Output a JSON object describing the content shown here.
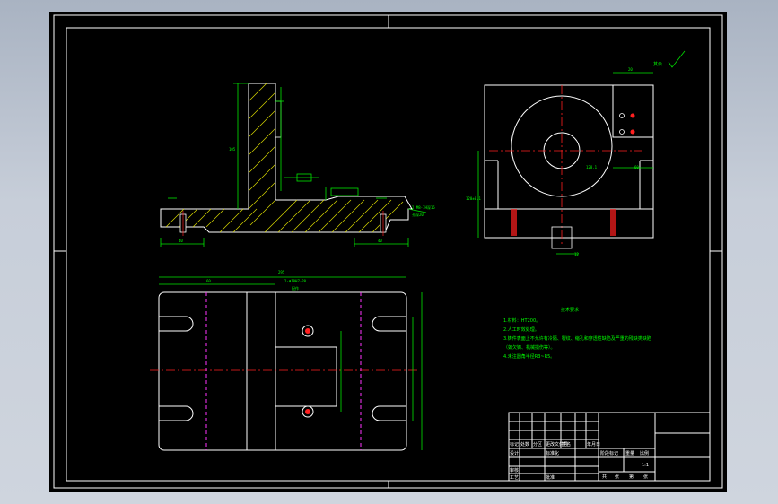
{
  "technical_requirements": {
    "title": "技术要求",
    "lines": [
      "1.材料：HT200。",
      "2.人工时效处理。",
      "3.铸件表面上不允许有冷隔、裂纹、缩孔和穿透性缺陷及严重的残缺类缺陷",
      "（如欠铸、机械损伤等）。",
      "4.未注圆角半径R3~R5。"
    ]
  },
  "roughness_note": "其余",
  "dimensions": {
    "top_overall": "295",
    "top_left": "60",
    "top_right_small": "20",
    "bolt_callout": "2-M8-7H深16",
    "bolt_callout_2": "孔深20",
    "hole_callout": "2-Φ10H7-20",
    "hole_callout_2": "配作",
    "base_left": "40",
    "base_right": "40",
    "side_height": "105",
    "right_w": "20",
    "right_h": "128.1",
    "right_h2": "60",
    "right_bottom": "12",
    "height_mark": "120±0.1"
  },
  "title_block": {
    "cells_left": [
      "标记",
      "处数",
      "分区",
      "更改文件号",
      "签名",
      "年月日"
    ],
    "cells_design": [
      "设计",
      "标准化"
    ],
    "cells_check": [
      "审核",
      "工艺",
      "批准"
    ],
    "stage_labels": [
      "阶段标记",
      "重量",
      "比例"
    ],
    "scale": "1:1",
    "sheet_labels": [
      "共",
      "张",
      "第",
      "张"
    ]
  }
}
